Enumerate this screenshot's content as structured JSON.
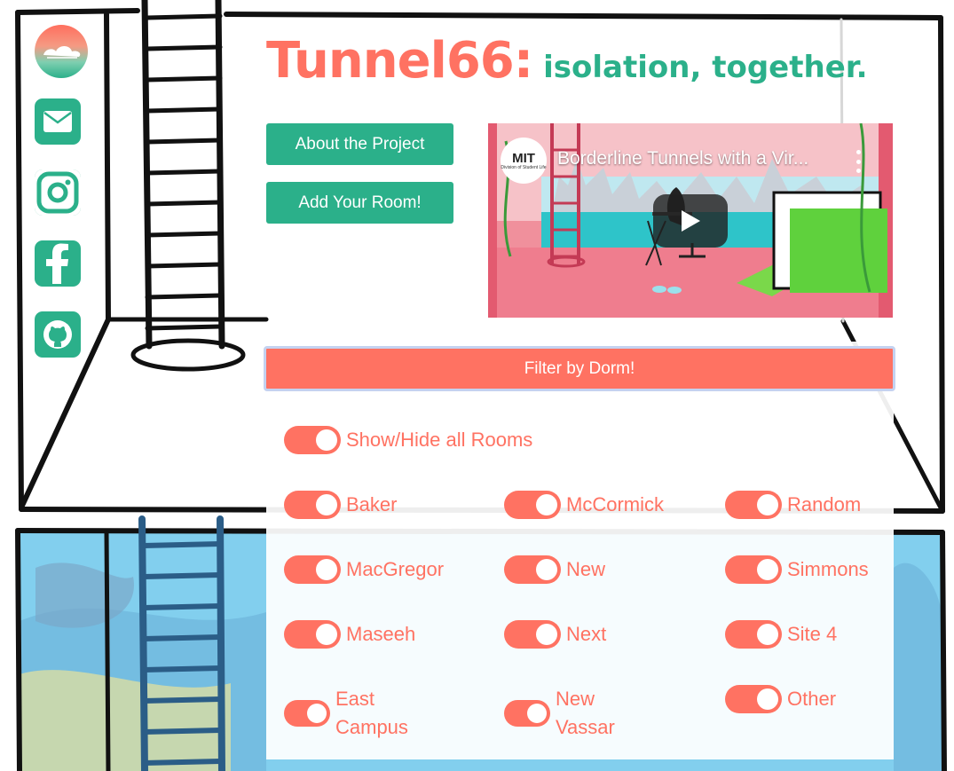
{
  "brand": {
    "logo": "cloud-logo-icon"
  },
  "sidebar": {
    "icons": [
      "envelope-icon",
      "instagram-icon",
      "facebook-icon",
      "github-icon"
    ]
  },
  "header": {
    "title": "Tunnel66:",
    "subtitle": "isolation, together."
  },
  "buttons": {
    "about": "About the Project",
    "add_room": "Add Your Room!"
  },
  "video": {
    "channel": "MIT",
    "channel_sub": "Division of Student Life",
    "title": "Borderline Tunnels with a Vir..."
  },
  "filter": {
    "button_label": "Filter by Dorm!",
    "master_toggle": {
      "label": "Show/Hide all Rooms",
      "on": true
    },
    "dorms": [
      {
        "label": "Baker",
        "on": true
      },
      {
        "label": "McCormick",
        "on": true
      },
      {
        "label": "Random",
        "on": true
      },
      {
        "label": "MacGregor",
        "on": true
      },
      {
        "label": "New",
        "on": true
      },
      {
        "label": "Simmons",
        "on": true
      },
      {
        "label": "Maseeh",
        "on": true
      },
      {
        "label": "Next",
        "on": true
      },
      {
        "label": "Site 4",
        "on": true
      },
      {
        "label": "East Campus",
        "on": true
      },
      {
        "label": "New Vassar",
        "on": true
      },
      {
        "label": "Other",
        "on": true
      }
    ]
  },
  "colors": {
    "coral": "#ff7262",
    "green": "#2bb08a",
    "sky": "#7fd0ee"
  }
}
